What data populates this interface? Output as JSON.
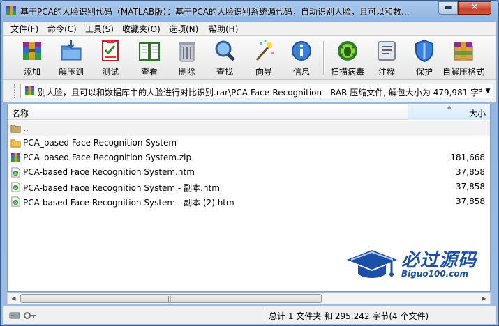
{
  "window": {
    "title": "基于PCA的人脸识别代码（MATLAB版）：基于PCA的人脸识别系统源代码，自动识别人脸，且可以和数...",
    "min_glyph": "▬",
    "close_glyph": "✕"
  },
  "menu": [
    {
      "label": "文件(F)"
    },
    {
      "label": "命令(C)"
    },
    {
      "label": "工具(S)"
    },
    {
      "label": "收藏夹(O)"
    },
    {
      "label": "选项(N)"
    },
    {
      "label": "帮助(H)"
    }
  ],
  "toolbar": [
    {
      "label": "添加",
      "icon": "add-archive-icon"
    },
    {
      "label": "解压到",
      "icon": "extract-to-icon"
    },
    {
      "label": "测试",
      "icon": "test-icon"
    },
    {
      "label": "查看",
      "icon": "view-book-icon"
    },
    {
      "label": "删除",
      "icon": "trash-icon"
    },
    {
      "label": "查找",
      "icon": "search-icon"
    },
    {
      "label": "向导",
      "icon": "wizard-wand-icon"
    },
    {
      "label": "信息",
      "icon": "info-icon"
    },
    {
      "label": "扫描病毒",
      "icon": "virus-scan-icon"
    },
    {
      "label": "注释",
      "icon": "comment-icon"
    },
    {
      "label": "保护",
      "icon": "shield-icon"
    },
    {
      "label": "自解压格式",
      "icon": "sfx-box-icon"
    }
  ],
  "address": {
    "path": "别人脸，且可以和数据库中的人脸进行对比识别.rar\\PCA-Face-Recognition - RAR 压缩文件, 解包大小为 479,981 字节"
  },
  "columns": {
    "name": "名称",
    "size": "大小"
  },
  "files": [
    {
      "name": "..",
      "size": "",
      "icon": "parent-folder-icon"
    },
    {
      "name": "PCA_based Face Recognition System",
      "size": "",
      "icon": "folder-icon"
    },
    {
      "name": "PCA_based Face Recognition System.zip",
      "size": "181,668",
      "icon": "rar-archive-icon"
    },
    {
      "name": "PCA-based Face Recognition System.htm",
      "size": "37,858",
      "icon": "html-file-icon"
    },
    {
      "name": "PCA-based Face Recognition System - 副本.htm",
      "size": "37,858",
      "icon": "html-file-icon"
    },
    {
      "name": "PCA-based Face Recognition System - 副本 (2).htm",
      "size": "37,858",
      "icon": "html-file-icon"
    }
  ],
  "status": {
    "text": "总计 1 文件夹 和 295,242 字节(4 个文件)"
  },
  "watermark": {
    "title": "必过源码",
    "subtitle": "Biguo100.com"
  },
  "colors": {
    "accent": "#1b4fa8",
    "window_frame": "#8fb3e0"
  }
}
